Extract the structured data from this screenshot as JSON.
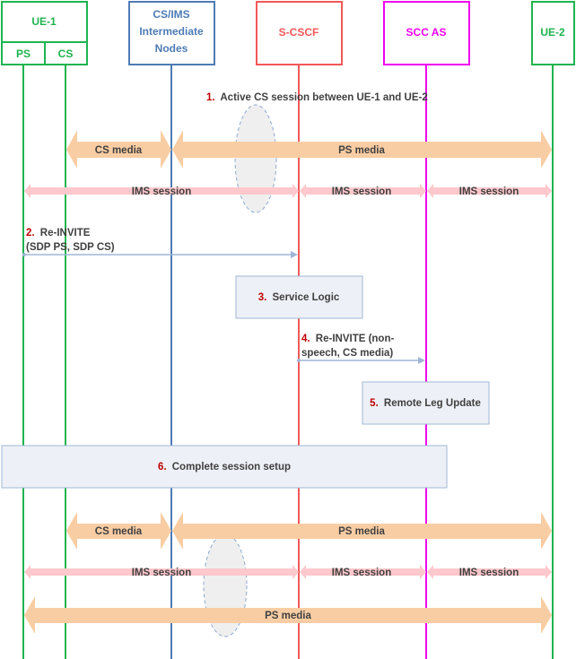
{
  "colors": {
    "ue": "#1fb44f",
    "intermediate": "#4f7bb5",
    "scscf": "#f25858",
    "sccas": "#ee00ee",
    "cs_media": "#f9cda3",
    "ims_session": "#ffc8cc",
    "message_arrow": "#9fb6d6",
    "step_box_fill": "#edf0f6",
    "step_box_border": "#a1b7d6",
    "step_number": "#c00000",
    "text": "#404040",
    "ellipse_fill": "#efefef",
    "ellipse_border": "#8ea9cf"
  },
  "nodes": {
    "ue1": {
      "label": "UE-1",
      "sub_left": "PS",
      "sub_right": "CS"
    },
    "intermediate": {
      "line1": "CS/IMS",
      "line2": "Intermediate",
      "line3": "Nodes"
    },
    "scscf": {
      "label": "S-CSCF"
    },
    "sccas": {
      "label": "SCC AS"
    },
    "ue2": {
      "label": "UE-2"
    }
  },
  "steps": [
    {
      "num": "1.",
      "text": "Active CS session between UE-1 and UE-2"
    },
    {
      "num": "2.",
      "line1": "Re-INVITE",
      "line2": "(SDP PS, SDP CS)"
    },
    {
      "num": "3.",
      "text": "Service Logic"
    },
    {
      "num": "4.",
      "line1": "Re-INVITE (non-",
      "line2": "speech, CS media)"
    },
    {
      "num": "5.",
      "text": "Remote Leg Update"
    },
    {
      "num": "6.",
      "text": "Complete session setup"
    }
  ],
  "flows_before": {
    "cs_media": "CS media",
    "ps_media": "PS media",
    "ims_session_1": "IMS session",
    "ims_session_2": "IMS session",
    "ims_session_3": "IMS session"
  },
  "flows_after": {
    "cs_media": "CS media",
    "ps_media": "PS media",
    "ims_session_1": "IMS session",
    "ims_session_2": "IMS session",
    "ims_session_3": "IMS session",
    "ps_media_full": "PS media"
  }
}
